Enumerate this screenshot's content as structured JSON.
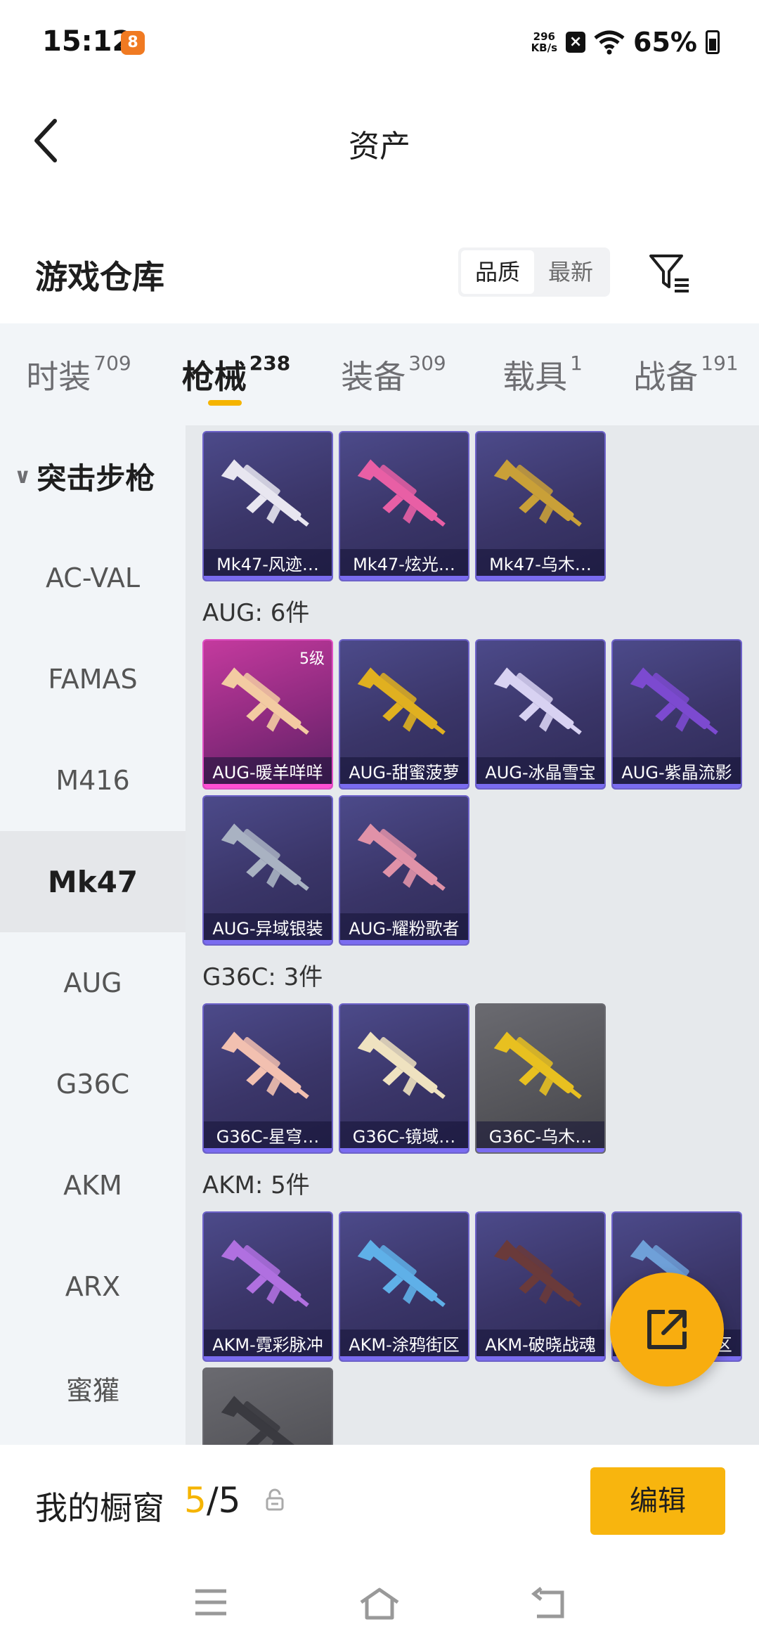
{
  "status_bar": {
    "time": "15:12",
    "app_icon_glyph": "8",
    "net_speed_value": "296",
    "net_speed_unit": "KB/s",
    "battery_pct": "65%",
    "icons": [
      "notification-app-icon",
      "close-box-icon",
      "wifi-icon",
      "battery-icon"
    ]
  },
  "header": {
    "title": "资产"
  },
  "section": {
    "title": "游戏仓库",
    "sort_options": [
      "品质",
      "最新"
    ],
    "sort_selected": "品质"
  },
  "tabs": [
    {
      "label": "时装",
      "count": "709"
    },
    {
      "label": "枪械",
      "count": "238",
      "active": true
    },
    {
      "label": "装备",
      "count": "309"
    },
    {
      "label": "载具",
      "count": "1"
    },
    {
      "label": "战备",
      "count": "191"
    }
  ],
  "sidebar": {
    "group": "突击步枪",
    "items": [
      "AC-VAL",
      "FAMAS",
      "M416",
      "Mk47",
      "AUG",
      "G36C",
      "AKM",
      "ARX",
      "蜜獾"
    ],
    "active": "Mk47"
  },
  "groups": [
    {
      "title": "",
      "items": [
        {
          "label": "Mk47-风迹…",
          "style": "purple",
          "gun_color": "#e8e6f0"
        },
        {
          "label": "Mk47-炫光…",
          "style": "purple",
          "gun_color": "#e85fa5"
        },
        {
          "label": "Mk47-乌木…",
          "style": "purple",
          "gun_color": "#c9a038"
        }
      ]
    },
    {
      "title": "AUG: 6件",
      "items": [
        {
          "label": "AUG-暖羊咩咩",
          "style": "pink",
          "level": "5级",
          "gun_color": "#f3cba2"
        },
        {
          "label": "AUG-甜蜜菠萝",
          "style": "purple",
          "gun_color": "#e0b020"
        },
        {
          "label": "AUG-冰晶雪宝",
          "style": "purple",
          "gun_color": "#d8d2f2"
        },
        {
          "label": "AUG-紫晶流影",
          "style": "purple",
          "gun_color": "#7c4ad0"
        },
        {
          "label": "AUG-异域银装",
          "style": "purple",
          "gun_color": "#a9b2c2"
        },
        {
          "label": "AUG-耀粉歌者",
          "style": "purple",
          "gun_color": "#e092a8"
        }
      ]
    },
    {
      "title": "G36C: 3件",
      "items": [
        {
          "label": "G36C-星穹…",
          "style": "purple",
          "gun_color": "#f2c0b0"
        },
        {
          "label": "G36C-镜域…",
          "style": "purple",
          "gun_color": "#efe2c0"
        },
        {
          "label": "G36C-乌木…",
          "style": "grey",
          "gun_color": "#e8c020"
        }
      ]
    },
    {
      "title": "AKM: 5件",
      "items": [
        {
          "label": "AKM-霓彩脉冲",
          "style": "purple",
          "gun_color": "#b070e0"
        },
        {
          "label": "AKM-涂鸦街区",
          "style": "purple",
          "gun_color": "#5fb0e8"
        },
        {
          "label": "AKM-破晓战魂",
          "style": "purple",
          "gun_color": "#6a3a3a"
        },
        {
          "label": "AKM-涂鸦街区",
          "style": "purple",
          "gun_color": "#6fa0d8"
        },
        {
          "label": "",
          "style": "grey",
          "gun_color": "#3a3a40"
        }
      ]
    }
  ],
  "showcase": {
    "label": "我的橱窗",
    "current": "5",
    "total": "/5",
    "edit_label": "编辑"
  },
  "fab": {
    "icon": "share-external-icon"
  },
  "navbar": {
    "icons": [
      "menu-icon",
      "home-icon",
      "back-icon"
    ]
  }
}
